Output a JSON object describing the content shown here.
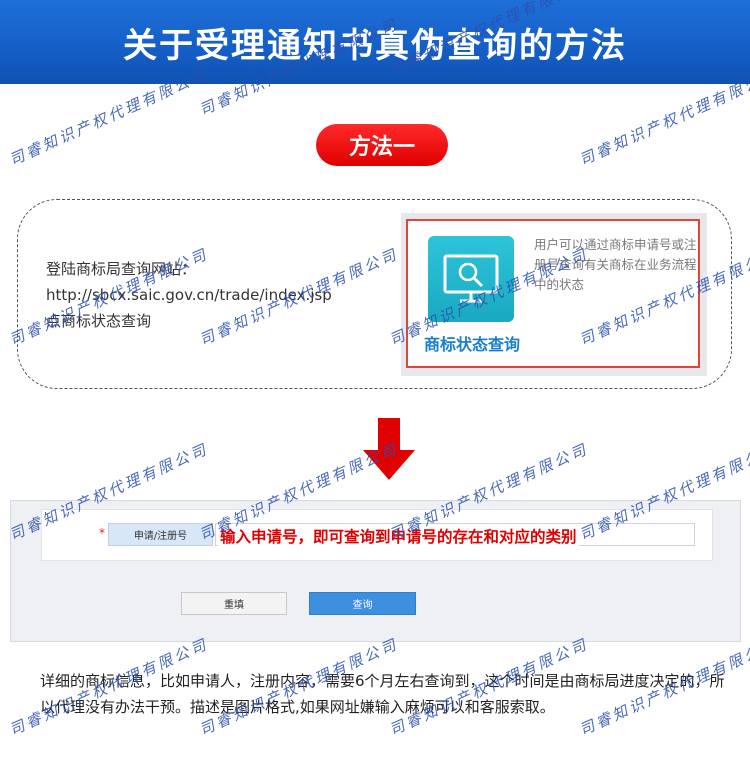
{
  "banner": {
    "title": "关于受理通知书真伪查询的方法"
  },
  "method": {
    "badge": "方法一",
    "intro": [
      "登陆商标局查询网站：",
      "http://sbcx.saic.gov.cn/trade/index.jsp",
      "点商标状态查询"
    ],
    "screenshot": {
      "caption": "商标状态查询",
      "description": "用户可以通过商标申请号或注册号查询有关商标在业务流程中的状态"
    }
  },
  "form": {
    "field_label": "申请/注册号",
    "hint": "输入申请号，即可查询到申请号的存在和对应的类别",
    "reset_label": "重填",
    "query_label": "查询"
  },
  "description": "详细的商标信息，比如申请人，注册内容，需要6个月左右查询到，这个时间是由商标局进度决定的，所以代理没有办法干预。描述是图片格式,如果网址嫌输入麻烦可以和客服索取。",
  "watermark": "司睿知识产权代理有限公司",
  "colors": {
    "banner_blue": "#1560c8",
    "accent_red": "#e00000",
    "link_blue": "#1b7fcf"
  }
}
